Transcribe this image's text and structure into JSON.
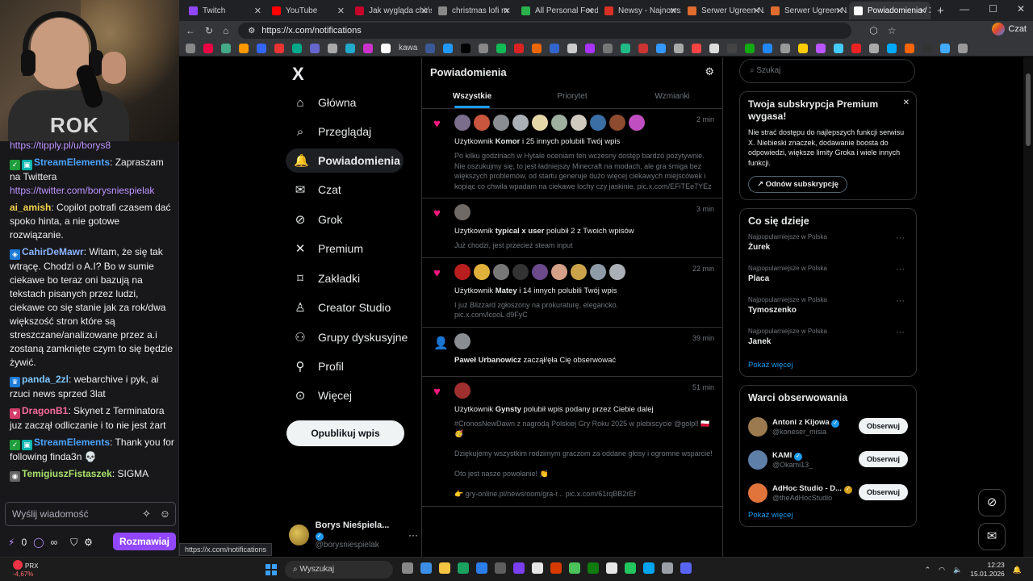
{
  "chat": {
    "messages": [
      {
        "badges": [],
        "user": "",
        "user_color": "",
        "text": "",
        "link": "https://tipply.pl/u/borys8"
      },
      {
        "badges": [
          "check",
          "bot"
        ],
        "user": "StreamElements",
        "user_color": "#4aa3ff",
        "text": ": Zapraszam na Twittera",
        "link": "https://twitter.com/borysniespielak"
      },
      {
        "badges": [],
        "user": "ai_amish",
        "user_color": "#f2d34b",
        "text": ": Copilot potrafi czasem dać spoko hinta, a nie gotowe rozwiązanie.",
        "link": ""
      },
      {
        "badges": [
          "sub"
        ],
        "user": "CahirDeMawr",
        "user_color": "#8ab4ff",
        "text": ": Witam, że się tak wtrącę. Chodzi o A.I? Bo w sumie ciekawe bo teraz oni bazują na tekstach pisanych przez ludzi, ciekawe co się stanie jak za rok/dwa większość stron które są streszczane/analizowane przez a.i zostaną zamknięte czym to się będzie żywić.",
        "link": ""
      },
      {
        "badges": [
          "crown"
        ],
        "user": "panda_2zl",
        "user_color": "#7ec8ff",
        "text": ": webarchive i pyk, ai rzuci news sprzed 3lat",
        "link": ""
      },
      {
        "badges": [
          "heart"
        ],
        "user": "DragonB1",
        "user_color": "#ff6b9a",
        "text": ": Skynet z Terminatora juz zaczął odliczanie i to nie jest żart",
        "link": ""
      },
      {
        "badges": [
          "check",
          "bot"
        ],
        "user": "StreamElements",
        "user_color": "#4aa3ff",
        "text": ": Thank you for following finda3n 💀",
        "link": ""
      },
      {
        "badges": [
          "gray"
        ],
        "user": "TemigiuszFistaszek",
        "user_color": "#a8e06b",
        "text": ": SIGMA",
        "link": ""
      }
    ],
    "input_placeholder": "Wyślij wiadomość",
    "points": "0",
    "infinity": "∞",
    "send_label": "Rozmawiaj"
  },
  "browser": {
    "tabs": [
      {
        "title": "Twitch",
        "color": "#9146ff",
        "active": false
      },
      {
        "title": "YouTube",
        "color": "#ff0000",
        "active": false
      },
      {
        "title": "Jak wygląda chińsk",
        "color": "#c4002b",
        "active": false
      },
      {
        "title": "christmas lofi m",
        "color": "#888888",
        "active": false
      },
      {
        "title": "All Personal Feeds",
        "color": "#2bb24c",
        "active": false
      },
      {
        "title": "Newsy - Najnowsz",
        "color": "#d93025",
        "active": false
      },
      {
        "title": "Serwer Ugreen NAS",
        "color": "#e06c2e",
        "active": false
      },
      {
        "title": "Serwer Ugreen NAS",
        "color": "#e06c2e",
        "active": false
      },
      {
        "title": "Powiadomienia / X",
        "color": "#ffffff",
        "active": true
      }
    ],
    "url": "https://x.com/notifications",
    "profile_label": "Czat",
    "bookmark_label": "kawa",
    "status_url": "https://x.com/notifications"
  },
  "x": {
    "logo": "X",
    "nav": [
      {
        "label": "Główna",
        "icon": "home-icon",
        "glyph": "⌂",
        "active": false
      },
      {
        "label": "Przeglądaj",
        "icon": "search-icon",
        "glyph": "⌕",
        "active": false
      },
      {
        "label": "Powiadomienia",
        "icon": "bell-icon",
        "glyph": "🔔",
        "active": true
      },
      {
        "label": "Czat",
        "icon": "mail-icon",
        "glyph": "✉",
        "active": false
      },
      {
        "label": "Grok",
        "icon": "grok-icon",
        "glyph": "⊘",
        "active": false
      },
      {
        "label": "Premium",
        "icon": "x-premium-icon",
        "glyph": "✕",
        "active": false
      },
      {
        "label": "Zakładki",
        "icon": "bookmark-icon",
        "glyph": "⌑",
        "active": false
      },
      {
        "label": "Creator Studio",
        "icon": "creator-studio-icon",
        "glyph": "♙",
        "active": false
      },
      {
        "label": "Grupy dyskusyjne",
        "icon": "communities-icon",
        "glyph": "⚇",
        "active": false
      },
      {
        "label": "Profil",
        "icon": "profile-icon",
        "glyph": "⚲",
        "active": false
      },
      {
        "label": "Więcej",
        "icon": "more-icon",
        "glyph": "⊙",
        "active": false
      }
    ],
    "post_button": "Opublikuj wpis",
    "account": {
      "name": "Borys Nieśpiela...",
      "handle": "@borysniespielak"
    },
    "header": "Powiadomienia",
    "tabs": [
      "Wszystkie",
      "Priorytet",
      "Wzmianki"
    ],
    "notifications": [
      {
        "kind": "like",
        "time": "2 min",
        "avatars": [
          "#7a6e8c",
          "#c8553d",
          "#8a8d91",
          "#aab0b5",
          "#e6d7a8",
          "#9fb0a0",
          "#d0c9be",
          "#3a6ea5",
          "#8c4a2f",
          "#c04ec0"
        ],
        "title_pre": "Użytkownik ",
        "title_user": "Komor",
        "title_post": " i 25 innych polubili Twój wpis",
        "body": "Po kilku godzinach w Hytale oceniam ten wczesny dostęp bardzo pozytywnie.\nNie oszukujmy się, to jest ładniejszy Minecraft na modach, ale gra śmiga bez większych problemów, od startu generuje dużo więcej ciekawych miejscówek i kopiąc co chwila wpadam na ciekawe lochy czy jaskinie. pic.x.com/EFiTEe7YEz"
      },
      {
        "kind": "like",
        "time": "3 min",
        "avatars": [
          "#6f6a66"
        ],
        "title_pre": "Użytkownik ",
        "title_user": "typical x user",
        "title_post": " polubił 2 z Twoich wpisów",
        "body": "Już chodzi, jest przecież steam input"
      },
      {
        "kind": "like",
        "time": "22 min",
        "avatars": [
          "#b81e1e",
          "#e0b13a",
          "#777777",
          "#333333",
          "#6a4a8a",
          "#d4a087",
          "#c9a24a",
          "#8e9aa6",
          "#aab0b5"
        ],
        "title_pre": "Użytkownik ",
        "title_user": "Matey",
        "title_post": " i 14 innych polubili Twój wpis",
        "body": "I już Blizzard zgłoszony na prokuraturę, elegancko.\npic.x.com/lcooL d9FyC"
      },
      {
        "kind": "follow",
        "time": "39 min",
        "avatars": [
          "#8a8d91"
        ],
        "title_pre": "",
        "title_user": "Paweł Urbanowicz",
        "title_post": " zaczął/ęła Cię obserwować",
        "body": ""
      },
      {
        "kind": "like",
        "time": "51 min",
        "avatars": [
          "#a03030"
        ],
        "title_pre": "Użytkownik ",
        "title_user": "Gynsty",
        "title_post": " polubił wpis podany przez Ciebie dalej",
        "body": "#CronosNewDawn z nagrodą Polskiej Gry Roku 2025 w plebiscycie @golpl! 🇵🇱 🥳\n\nDziękujemy wszystkim rodzimym graczom za oddane głosy i ogromne wsparcie!\n\nOto jest nasze powołanie! 👏\n\n👉 gry-online.pl/newsroom/gra-r... pic.x.com/61rqBB2rEf"
      }
    ],
    "search_placeholder": "Szukaj",
    "premium": {
      "title": "Twoja subskrypcja Premium wygasa!",
      "text": "Nie strać dostępu do najlepszych funkcji serwisu X. Niebieski znaczek, dodawanie boosta do odpowiedzi, większe limity Groka i wiele innych funkcji.",
      "button": "Odnów subskrypcję"
    },
    "trends": {
      "title": "Co się dzieje",
      "items": [
        {
          "context": "Najpopularniejsze w Polska",
          "name": "Żurek"
        },
        {
          "context": "Najpopularniejsze w Polska",
          "name": "Placa"
        },
        {
          "context": "Najpopularniejsze w Polska",
          "name": "Tymoszenko"
        },
        {
          "context": "Najpopularniejsze w Polska",
          "name": "Janek"
        }
      ],
      "show_more": "Pokaż więcej"
    },
    "who_to_follow": {
      "title": "Warci obserwowania",
      "items": [
        {
          "name": "Antoni z Kijowa",
          "handle": "@koneser_misia",
          "badge": "blue",
          "avatar_color": "#9a7a4e"
        },
        {
          "name": "KAMI",
          "handle": "@Okami13_",
          "badge": "blue",
          "avatar_color": "#5e7fa8"
        },
        {
          "name": "AdHoc Studio - D...",
          "handle": "@theAdHocStudio",
          "badge": "gold",
          "avatar_color": "#e0743a"
        }
      ],
      "follow_label": "Obserwuj",
      "show_more": "Pokaż więcej"
    }
  },
  "taskbar": {
    "ticker": "PRX",
    "change": "-4,67%",
    "search": "Wyszukaj",
    "time": "12:23",
    "date": "15.01.2026"
  }
}
